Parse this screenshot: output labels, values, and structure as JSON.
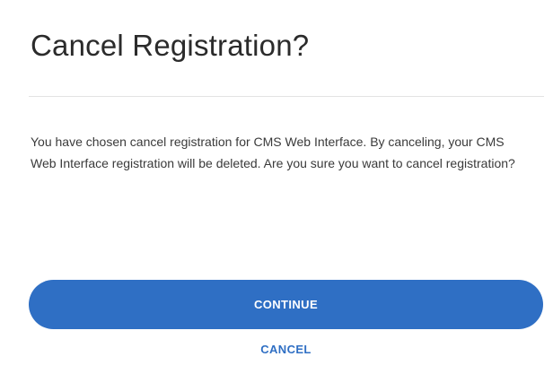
{
  "dialog": {
    "title": "Cancel Registration?",
    "message": "You have chosen cancel registration for CMS Web Interface. By canceling, your CMS Web Interface registration will be deleted. Are you sure you want to cancel registration?",
    "continue_label": "CONTINUE",
    "cancel_label": "CANCEL"
  },
  "colors": {
    "primary": "#2f6fc4",
    "title_text": "#2b2b2b",
    "body_text": "#3a3a3a",
    "divider": "#e3e3e3"
  }
}
